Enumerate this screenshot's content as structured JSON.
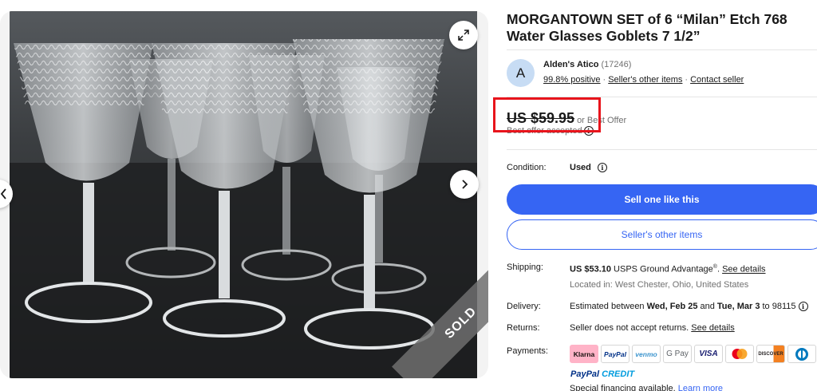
{
  "listing": {
    "title": "MORGANTOWN SET of 6 “Milan” Etch 768 Water Glasses Goblets 7 1/2”"
  },
  "image": {
    "sold_label": "SOLD",
    "icons": {
      "expand": "expand-icon",
      "next": "chevron-right-icon",
      "prev": "chevron-left-icon"
    }
  },
  "seller": {
    "avatar_letter": "A",
    "name": "Alden's Atico",
    "feedback_count": "(17246)",
    "positive": "99.8% positive",
    "other_items_link": "Seller's other items",
    "contact_link": "Contact seller",
    "separator": "·"
  },
  "price": {
    "amount": "US $59.95",
    "or_best_offer": "or Best Offer",
    "offer_status": "Best offer accepted"
  },
  "condition": {
    "label": "Condition:",
    "value": "Used"
  },
  "buttons": {
    "sell_one": "Sell one like this",
    "seller_other_items": "Seller's other items"
  },
  "shipping": {
    "label": "Shipping:",
    "cost": "US $53.10",
    "service": "USPS Ground Advantage",
    "service_mark": "®",
    "details_link": "See details",
    "location": "Located in: West Chester, Ohio, United States"
  },
  "delivery": {
    "label": "Delivery:",
    "prefix": "Estimated between",
    "start": "Wed, Feb 25",
    "and": "and",
    "end": "Tue, Mar 3",
    "to": "to 98115"
  },
  "returns": {
    "label": "Returns:",
    "text": "Seller does not accept returns.",
    "details_link": "See details"
  },
  "payments": {
    "label": "Payments:",
    "methods": [
      "Klarna",
      "PayPal",
      "venmo",
      "G Pay",
      "VISA",
      "Mastercard",
      "DISCOVER",
      "Diners Club"
    ],
    "paypal_credit_a": "PayPal",
    "paypal_credit_b": "CREDIT",
    "financing_text": "Special financing available.",
    "learn_more": "Learn more"
  },
  "colors": {
    "accent_blue": "#3665f3",
    "highlight_red": "#e8141c",
    "text": "#191919",
    "muted": "#707070"
  }
}
